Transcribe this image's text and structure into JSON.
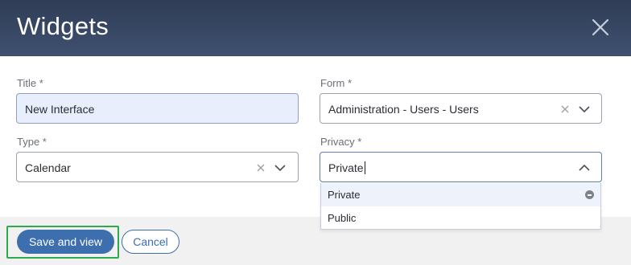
{
  "dialog": {
    "title": "Widgets"
  },
  "form": {
    "title": {
      "label": "Title *",
      "value": "New Interface"
    },
    "form": {
      "label": "Form *",
      "value": "Administration - Users - Users"
    },
    "type": {
      "label": "Type *",
      "value": "Calendar"
    },
    "privacy": {
      "label": "Privacy *",
      "value": "Private",
      "options": [
        "Private",
        "Public"
      ],
      "selected": "Private"
    }
  },
  "footer": {
    "save_label": "Save and view",
    "cancel_label": "Cancel"
  },
  "colors": {
    "header": "#34435f",
    "primary": "#3d6eae",
    "highlight": "#2fa84f",
    "active_field": "#e8eefc"
  },
  "icons": [
    "close-icon",
    "clear-icon",
    "chevron-down-icon",
    "chevron-up-icon",
    "remove-option-icon"
  ]
}
